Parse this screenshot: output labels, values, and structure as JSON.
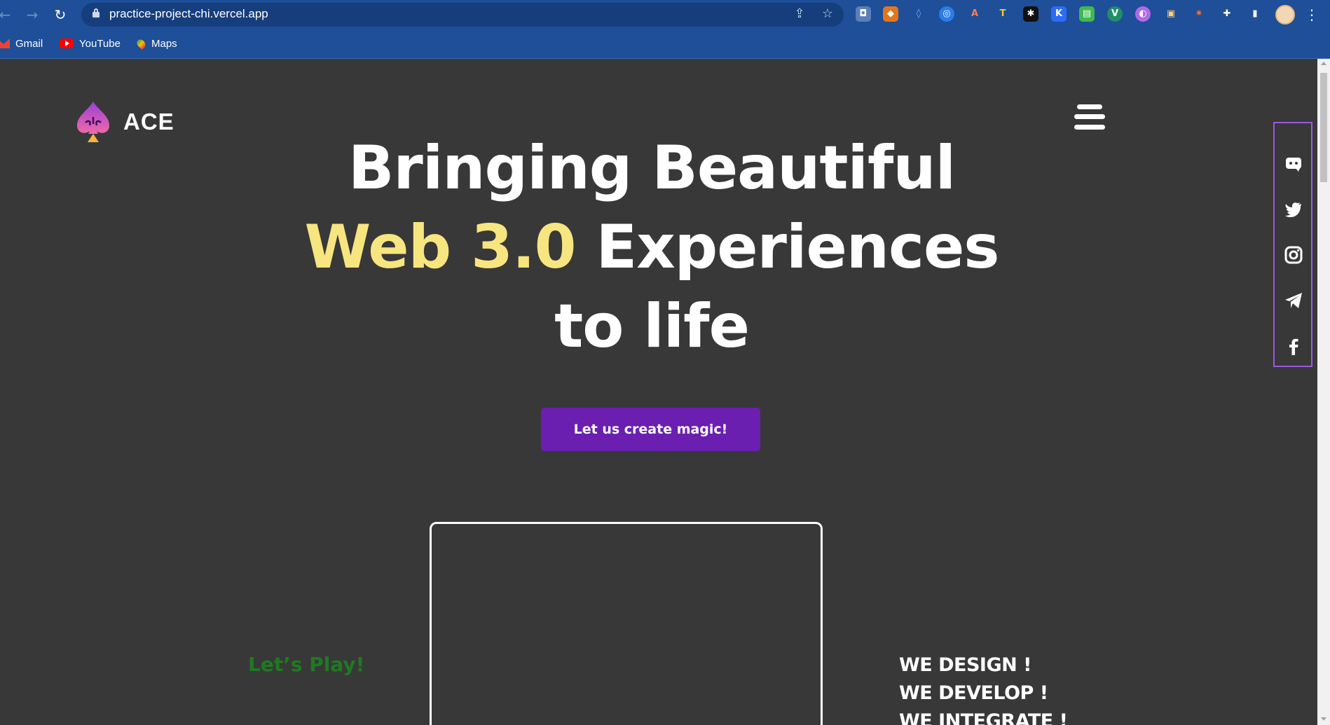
{
  "browser": {
    "url": "practice-project-chi.vercel.app",
    "bookmarks": [
      {
        "label": "Gmail",
        "icon": "gmail-icon"
      },
      {
        "label": "YouTube",
        "icon": "youtube-icon"
      },
      {
        "label": "Maps",
        "icon": "maps-icon"
      }
    ],
    "colors": {
      "chrome": "#1e4f98",
      "omnibox": "#163e7c"
    }
  },
  "site": {
    "brand": "ACE",
    "hero": {
      "line1": "Bringing Beautiful",
      "line2_accent": "Web 3.0",
      "line2_rest": " Experiences",
      "line3": "to life"
    },
    "cta_label": "Let us create magic!",
    "lets_play": "Let’s Play!",
    "we_list": [
      "WE DESIGN !",
      "WE DEVELOP !",
      "WE INTEGRATE !"
    ],
    "social": [
      "discord-icon",
      "twitter-icon",
      "instagram-icon",
      "telegram-icon",
      "facebook-icon"
    ],
    "colors": {
      "background": "#383838",
      "accent": "#f7e57f",
      "cta": "#6a1fb0",
      "social_border": "#9b59e0",
      "lets_play": "#1f7a1f"
    }
  }
}
